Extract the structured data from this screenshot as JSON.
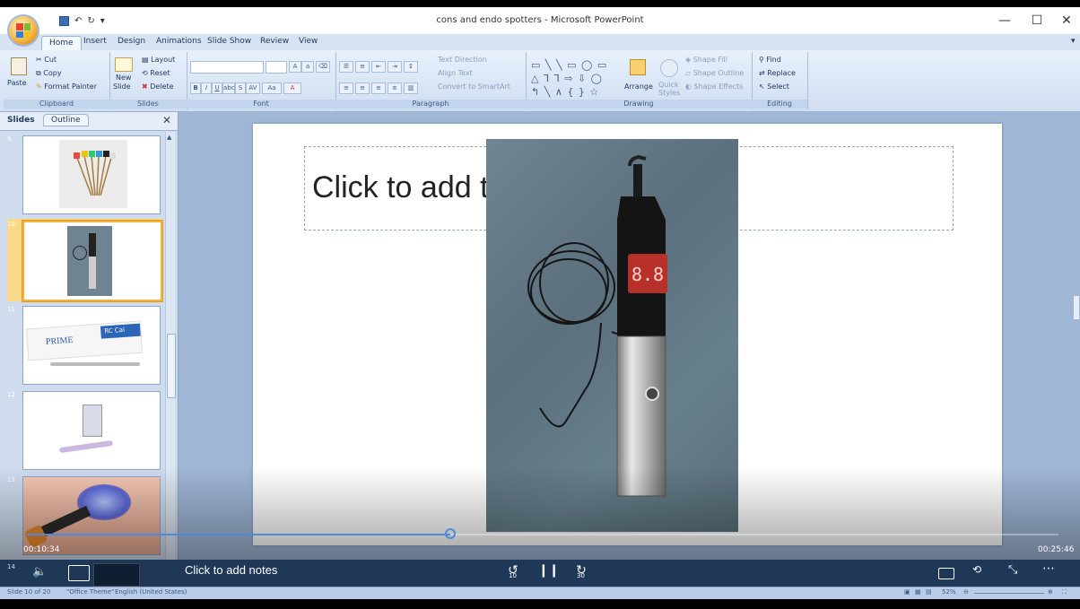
{
  "window": {
    "title": "cons and endo spotters - Microsoft PowerPoint",
    "controls": {
      "minimize": "—",
      "maximize": "☐",
      "close": "✕"
    }
  },
  "back_arrow": "←",
  "ribbon_tabs": [
    "Home",
    "Insert",
    "Design",
    "Animations",
    "Slide Show",
    "Review",
    "View"
  ],
  "ribbon": {
    "clipboard": {
      "paste": "Paste",
      "cut": "Cut",
      "copy": "Copy",
      "format_painter": "Format Painter",
      "label": "Clipboard"
    },
    "slides": {
      "new_slide_1": "New",
      "new_slide_2": "Slide",
      "layout": "Layout",
      "reset": "Reset",
      "delete": "Delete",
      "label": "Slides"
    },
    "font": {
      "label": "Font"
    },
    "paragraph": {
      "text_direction": "Text Direction",
      "align_text": "Align Text",
      "convert_smartart": "Convert to SmartArt",
      "label": "Paragraph"
    },
    "drawing": {
      "arrange": "Arrange",
      "quick_styles_1": "Quick",
      "quick_styles_2": "Styles",
      "shape_fill": "Shape Fill",
      "shape_outline": "Shape Outline",
      "shape_effects": "Shape Effects",
      "label": "Drawing"
    },
    "editing": {
      "find": "Find",
      "replace": "Replace",
      "select": "Select",
      "label": "Editing"
    }
  },
  "panel": {
    "tab_slides": "Slides",
    "tab_outline": "Outline",
    "close": "✕",
    "thumbnails": [
      {
        "number": "9"
      },
      {
        "number": "10"
      },
      {
        "number": "11",
        "brand": "PRIME",
        "product": "RC Cal"
      },
      {
        "number": "12"
      },
      {
        "number": "13"
      },
      {
        "number": "14"
      }
    ]
  },
  "slide": {
    "title_placeholder": "Click to add t"
  },
  "device_display": "8.8",
  "player": {
    "elapsed": "00:10:34",
    "total": "00:25:46",
    "progress": 0.41,
    "rewind_label": "10",
    "forward_label": "30"
  },
  "notes_placeholder": "Click to add notes",
  "status": {
    "slide_info": "Slide 10 of 20",
    "theme": "\"Office Theme\"",
    "language": "English (United States)",
    "zoom": "52%"
  },
  "colors": {
    "ribbon": "#dbe6f4",
    "panel": "#cfdcee",
    "seek": "#4f8ad8",
    "selected_thumb": "#f3b23c"
  }
}
